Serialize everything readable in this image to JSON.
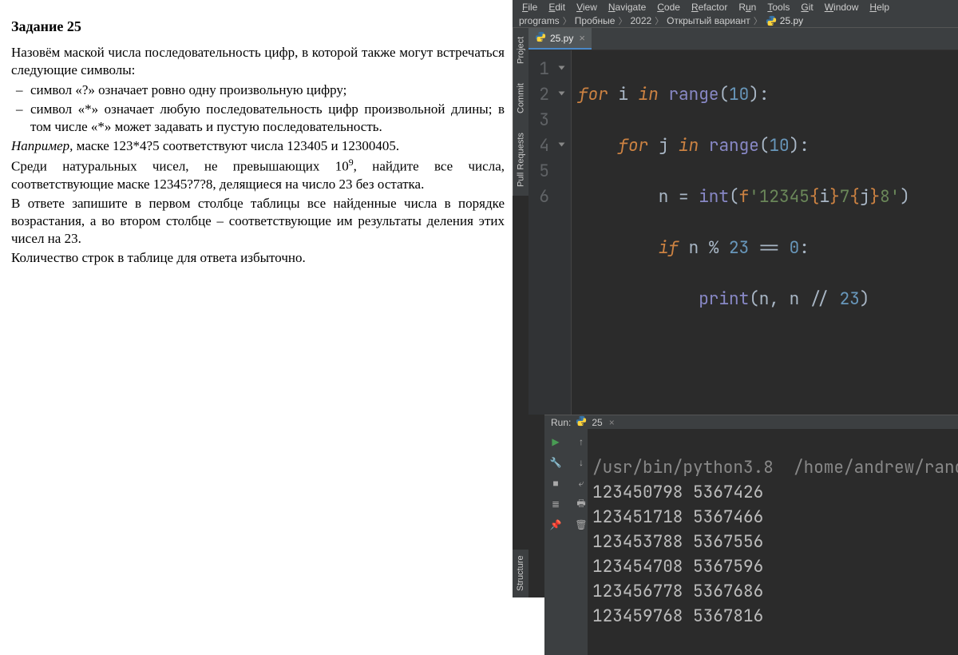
{
  "document": {
    "title": "Задание 25",
    "p1": "Назовём маской числа последовательность цифр, в которой также могут встречаться следующие символы:",
    "li1": "символ «?» означает ровно одну произвольную цифру;",
    "li2": "символ «*» означает любую последовательность цифр произвольной длины; в том числе «*» может задавать и пустую последовательность.",
    "p2_prefix": "Например,",
    "p2_rest": " маске 123*4?5 соответствуют числа 123405 и 12300405.",
    "p3a": "Среди натуральных чисел, не превышающих 10",
    "p3sup": "9",
    "p3b": ", найдите все числа, соответствующие маске 12345?7?8, делящиеся на число 23 без остатка.",
    "p4": "В ответе запишите в первом столбце таблицы все найденные числа в порядке возрастания, а во втором столбце – соответствующие им результаты деления этих чисел на 23.",
    "p5": "Количество строк в таблице для ответа избыточно."
  },
  "menu": {
    "items": [
      "File",
      "Edit",
      "View",
      "Navigate",
      "Code",
      "Refactor",
      "Run",
      "Tools",
      "Git",
      "Window",
      "Help"
    ]
  },
  "breadcrumbs": [
    "programs",
    "Пробные",
    "2022",
    "Открытый вариант",
    "25.py"
  ],
  "tab": {
    "label": "25.py"
  },
  "tool_tabs": {
    "project": "Project",
    "commit": "Commit",
    "pull_requests": "Pull Requests",
    "structure": "Structure"
  },
  "code": {
    "line_count": 6,
    "lines_raw": [
      "for i in range(10):",
      "    for j in range(10):",
      "        n = int(f'12345{i}7{j}8')",
      "        if n % 23 == 0:",
      "            print(n, n // 23)",
      ""
    ]
  },
  "run": {
    "label": "Run:",
    "config": "25",
    "header_line": "/usr/bin/python3.8  /home/andrew/rand",
    "output": [
      "123450798 5367426",
      "123451718 5367466",
      "123453788 5367556",
      "123454708 5367596",
      "123456778 5367686",
      "123459768 5367816"
    ]
  }
}
